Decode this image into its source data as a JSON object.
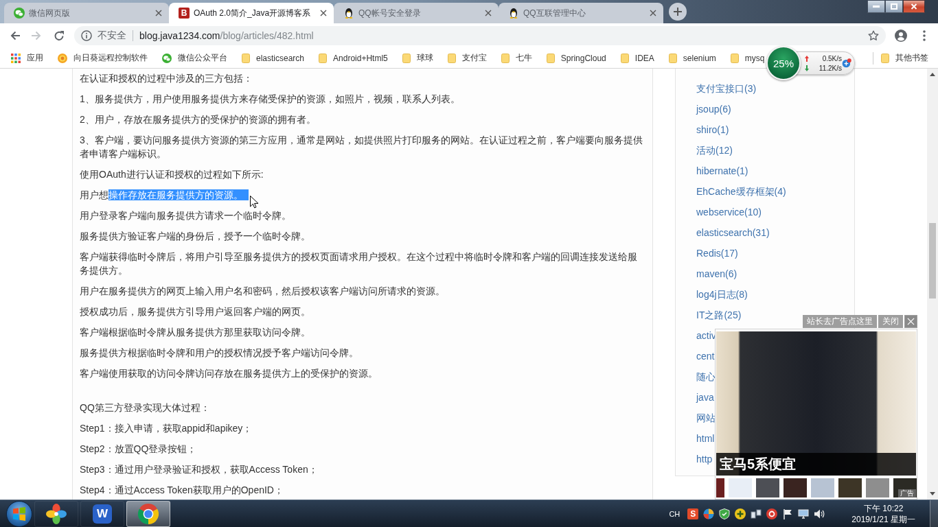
{
  "browser": {
    "tabs": [
      {
        "kind": "wechat",
        "title": "微信网页版",
        "selected": false
      },
      {
        "kind": "blog",
        "glyph": "B",
        "title": "OAuth 2.0简介_Java开源博客系",
        "selected": true
      },
      {
        "kind": "qq",
        "title": "QQ帐号安全登录",
        "selected": false
      },
      {
        "kind": "qq",
        "title": "QQ互联管理中心",
        "selected": false
      }
    ],
    "address": {
      "security": "不安全",
      "host": "blog.java1234.com",
      "path": "/blog/articles/482.html"
    },
    "bookmarks": [
      {
        "kind": "apps",
        "label": "应用"
      },
      {
        "kind": "flower",
        "label": "向日葵远程控制软件"
      },
      {
        "kind": "wechat",
        "label": "微信公众平台"
      },
      {
        "kind": "folder",
        "label": "elasticsearch"
      },
      {
        "kind": "folder",
        "label": "Android+Html5"
      },
      {
        "kind": "folder",
        "label": "球球"
      },
      {
        "kind": "folder",
        "label": "支付宝"
      },
      {
        "kind": "folder",
        "label": "七牛"
      },
      {
        "kind": "folder",
        "label": "SpringCloud"
      },
      {
        "kind": "folder",
        "label": "IDEA"
      },
      {
        "kind": "folder",
        "label": "selenium"
      },
      {
        "kind": "folder",
        "label": "mysq"
      }
    ],
    "other_bookmarks": {
      "kind": "folder",
      "label": "其他书签"
    }
  },
  "network_monitor": {
    "load": "25%",
    "upload": "0.5K/s",
    "download": "11.2K/s"
  },
  "article": {
    "sections": [
      {
        "paragraphs": [
          {
            "text": "在认证和授权的过程中涉及的三方包括："
          },
          {
            "text": "1、服务提供方，用户使用服务提供方来存储受保护的资源，如照片，视频，联系人列表。"
          },
          {
            "text": "2、用户，存放在服务提供方的受保护的资源的拥有者。"
          },
          {
            "text": "3、客户端，要访问服务提供方资源的第三方应用，通常是网站，如提供照片打印服务的网站。在认证过程之前，客户端要向服务提供者申请客户端标识。"
          },
          {
            "text": "使用OAuth进行认证和授权的过程如下所示:"
          },
          {
            "text": "用户想",
            "selection": "操作存放在服务提供方的资源。"
          },
          {
            "text": "用户登录客户端向服务提供方请求一个临时令牌。"
          },
          {
            "text": "服务提供方验证客户端的身份后，授予一个临时令牌。"
          },
          {
            "text": "客户端获得临时令牌后，将用户引导至服务提供方的授权页面请求用户授权。在这个过程中将临时令牌和客户端的回调连接发送给服务提供方。"
          },
          {
            "text": "用户在服务提供方的网页上输入用户名和密码，然后授权该客户端访问所请求的资源。"
          },
          {
            "text": "授权成功后，服务提供方引导用户返回客户端的网页。"
          },
          {
            "text": "客户端根据临时令牌从服务提供方那里获取访问令牌。"
          },
          {
            "text": "服务提供方根据临时令牌和用户的授权情况授予客户端访问令牌。"
          },
          {
            "text": "客户端使用获取的访问令牌访问存放在服务提供方上的受保护的资源。"
          }
        ]
      },
      {
        "paragraphs": [
          {
            "text": "QQ第三方登录实现大体过程："
          },
          {
            "text": "Step1：接入申请，获取appid和apikey；"
          },
          {
            "text": "Step2：放置QQ登录按钮；"
          },
          {
            "text": "Step3：通过用户登录验证和授权，获取Access Token；"
          },
          {
            "text": "Step4：通过Access Token获取用户的OpenID；"
          }
        ]
      }
    ]
  },
  "sidebar": {
    "categories": [
      "支付宝接口(3)",
      "jsoup(6)",
      "shiro(1)",
      "活动(12)",
      "hibernate(1)",
      "EhCache缓存框架(4)",
      "webservice(10)",
      "elasticsearch(31)",
      "Redis(17)",
      "maven(6)",
      "log4j日志(8)",
      "IT之路(25)",
      "activ",
      "cent",
      "随心",
      "java",
      "网站",
      "html",
      "http"
    ]
  },
  "ad": {
    "remove_ads": "站长去广告点这里",
    "close": "关闭",
    "caption": "宝马5系便宜",
    "label": "广告"
  },
  "taskbar": {
    "apps": [
      {
        "kind": "pinwheel",
        "selected": false
      },
      {
        "kind": "wps",
        "glyph": "W",
        "selected": false
      },
      {
        "kind": "chrome",
        "selected": true
      }
    ],
    "tray": {
      "language": "CH",
      "ime": "S"
    },
    "clock_time": "下午 10:22",
    "clock_date": "2019/1/21 星期一"
  }
}
